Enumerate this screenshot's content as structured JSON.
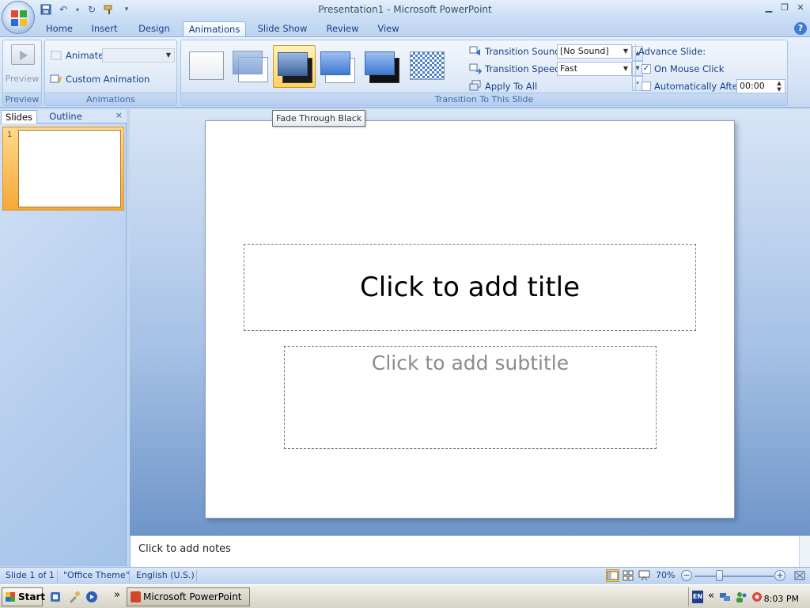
{
  "window": {
    "title": "Presentation1 - Microsoft PowerPoint"
  },
  "ribbon_tabs": [
    {
      "label": "Home"
    },
    {
      "label": "Insert"
    },
    {
      "label": "Design"
    },
    {
      "label": "Animations",
      "active": true
    },
    {
      "label": "Slide Show"
    },
    {
      "label": "Review"
    },
    {
      "label": "View"
    }
  ],
  "preview_group": {
    "button_label": "Preview",
    "group_label": "Preview"
  },
  "animations_group": {
    "animate_label": "Animate",
    "animate_value": "",
    "custom_animation_label": "Custom Animation",
    "group_label": "Animations"
  },
  "transition_group": {
    "sound_label": "Transition Sound",
    "sound_value": "[No Sound]",
    "speed_label": "Transition Speed",
    "speed_value": "Fast",
    "apply_all_label": "Apply To All",
    "group_label": "Transition To This Slide"
  },
  "advance_slide": {
    "heading": "Advance Slide:",
    "on_mouse_click_label": "On Mouse Click",
    "on_mouse_click_checked": true,
    "automatically_after_label": "Automatically After",
    "automatically_after_checked": false,
    "time_value": "00:00"
  },
  "tooltip": {
    "text": "Fade Through Black"
  },
  "slides_pane": {
    "tab_slides": "Slides",
    "tab_outline": "Outline",
    "close_glyph": "×",
    "slide_number": "1"
  },
  "slide": {
    "title_placeholder": "Click to add title",
    "subtitle_placeholder": "Click to add subtitle"
  },
  "notes": {
    "placeholder": "Click to add notes"
  },
  "status_bar": {
    "slide_info": "Slide 1 of 1",
    "theme": "\"Office Theme\"",
    "language": "English (U.S.)",
    "zoom": "70%"
  },
  "taskbar": {
    "start_label": "Start",
    "quick_launch_more": "»",
    "task_item": "Microsoft PowerPoint",
    "language_indicator": "EN",
    "tray_more": "«",
    "clock": "8:03 PM"
  },
  "colors": {
    "ribbon_text": "#15428b",
    "accent_selected": "#fbd980",
    "slide_thumb_highlight": "#f5a937"
  }
}
